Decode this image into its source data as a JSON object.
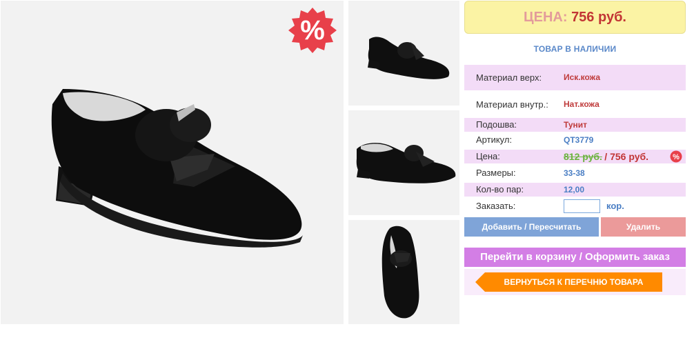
{
  "sale_badge": {
    "symbol": "%",
    "color": "#e8404a"
  },
  "images": {
    "main": "black-suede-shoe-with-fur-bow-side-view",
    "thumbs": [
      "shoe-three-quarter-view",
      "shoe-side-view",
      "shoe-top-view"
    ]
  },
  "panel": {
    "price_label": "ЦЕНА:",
    "price_value": "756 руб.",
    "stock_status": "ТОВАР В НАЛИЧИИ",
    "specs": {
      "upper_label": "Материал верх:",
      "upper_value": "Иск.кожа",
      "lining_label": "Материал внутр.:",
      "lining_value": "Нат.кожа",
      "sole_label": "Подошва:",
      "sole_value": "Тунит",
      "article_label": "Артикул:",
      "article_value": "QT3779",
      "price_label": "Цена:",
      "old_price": "812 руб.",
      "new_price": "/ 756 руб.",
      "sizes_label": "Размеры:",
      "sizes_value": "33-38",
      "pairs_label": "Кол-во пар:",
      "pairs_value": "12,00",
      "order_label": "Заказать:",
      "order_value": "",
      "order_unit": "кор."
    },
    "buttons": {
      "add": "Добавить / Пересчитать",
      "delete": "Удалить",
      "cart": "Перейти в корзину / Оформить заказ",
      "back": "ВЕРНУТЬСЯ К ПЕРЕЧНЮ ТОВАРА"
    }
  },
  "colors": {
    "price_bg": "#fbf3a4",
    "row_pink": "#f3dcf7",
    "blue_btn": "#7fa4d8",
    "red_btn": "#eb9a9a",
    "purple_btn": "#d37ee5",
    "orange_btn": "#ff8a00"
  }
}
